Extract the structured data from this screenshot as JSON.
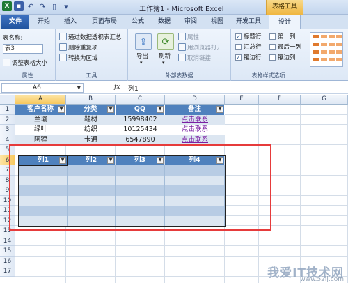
{
  "window": {
    "title": "工作簿1 - Microsoft Excel",
    "context_tab": "表格工具"
  },
  "tabs": [
    "文件",
    "开始",
    "插入",
    "页面布局",
    "公式",
    "数据",
    "审阅",
    "视图",
    "开发工具",
    "设计"
  ],
  "ribbon": {
    "properties": {
      "label": "表名称:",
      "value": "表3",
      "resize": "调整表格大小",
      "group": "属性"
    },
    "tools": {
      "pivot": "通过数据透视表汇总",
      "dedupe": "删除重复项",
      "convert": "转换为区域",
      "group": "工具"
    },
    "external": {
      "export": "导出",
      "refresh": "刷新",
      "properties": "属性",
      "open_browser": "用浏览器打开",
      "unlink": "取消链接",
      "group": "外部表数据"
    },
    "style_options": {
      "header_row": "标题行",
      "total_row": "汇总行",
      "banded_rows": "镶边行",
      "first_col": "第一列",
      "last_col": "最后一列",
      "banded_cols": "镶边列",
      "header_row_checked": true,
      "total_row_checked": false,
      "banded_rows_checked": true,
      "first_col_checked": false,
      "last_col_checked": false,
      "banded_cols_checked": false,
      "group": "表格样式选项"
    }
  },
  "formula_bar": {
    "name": "A6",
    "fx": "fx",
    "value": "列1"
  },
  "columns": [
    "A",
    "B",
    "C",
    "D",
    "E",
    "F",
    "G"
  ],
  "rows": [
    "1",
    "2",
    "3",
    "4",
    "5",
    "6",
    "7",
    "8",
    "9",
    "10",
    "11",
    "12",
    "13",
    "14",
    "15",
    "16",
    "17"
  ],
  "table1": {
    "headers": [
      "客户名称",
      "分类",
      "QQ",
      "备注"
    ],
    "rows": [
      [
        "兰瑜",
        "鞋材",
        "15998402",
        "点击联系"
      ],
      [
        "绿叶",
        "纺织",
        "10125434",
        "点击联系"
      ],
      [
        "阿狸",
        "卡通",
        "6547890",
        "点击联系"
      ]
    ]
  },
  "table2": {
    "headers": [
      "列1",
      "列2",
      "列3",
      "列4"
    ]
  },
  "watermark": {
    "text": "我爱IT技术网",
    "url": "www.52ij.com"
  },
  "colors": {
    "table_header": "#4f81bd",
    "band_light": "#dce6f1",
    "band_dark": "#b8cce4",
    "highlight_box": "#e63b3b"
  }
}
